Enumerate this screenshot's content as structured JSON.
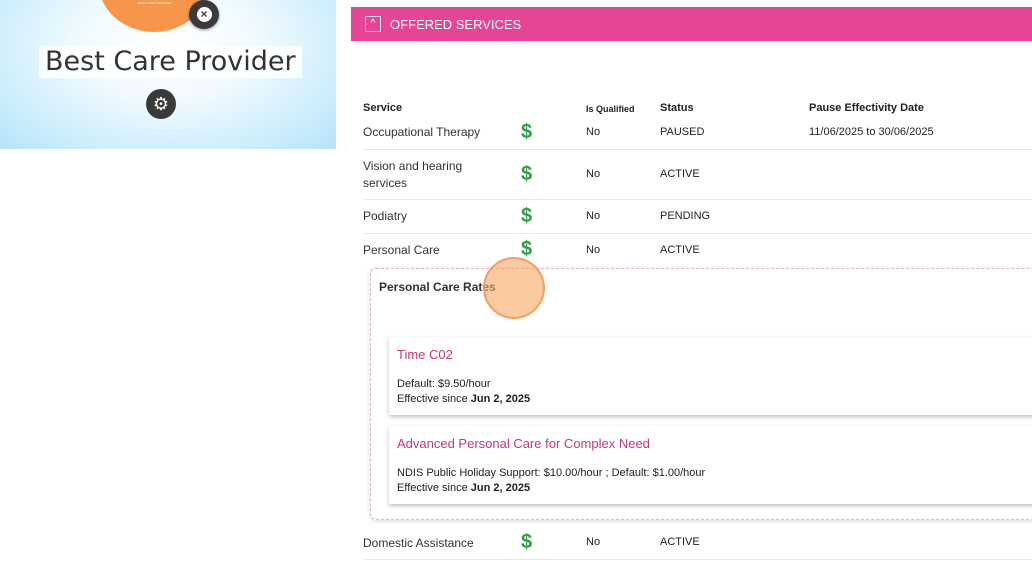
{
  "provider": {
    "name": "Best Care Provider",
    "logo_text": "BEST CARE PROVIDER"
  },
  "section": {
    "title": "OFFERED SERVICES",
    "toggle_symbol": "^"
  },
  "table": {
    "headers": {
      "service": "Service",
      "qualified": "Is Qualified",
      "status": "Status",
      "pause": "Pause Effectivity Date"
    },
    "rows": [
      {
        "name": "Occupational Therapy",
        "dollar": "$",
        "qualified": "No",
        "status": "PAUSED",
        "pause": "11/06/2025 to 30/06/2025"
      },
      {
        "name": "Vision and hearing services",
        "dollar": "$",
        "qualified": "No",
        "status": "ACTIVE",
        "pause": ""
      },
      {
        "name": "Podiatry",
        "dollar": "$",
        "qualified": "No",
        "status": "PENDING",
        "pause": ""
      },
      {
        "name": "Personal Care",
        "dollar": "$",
        "qualified": "No",
        "status": "ACTIVE",
        "pause": ""
      },
      {
        "name": "Domestic Assistance",
        "dollar": "$",
        "qualified": "No",
        "status": "ACTIVE",
        "pause": ""
      }
    ]
  },
  "rates": {
    "title": "Personal Care Rates",
    "cards": [
      {
        "name": "Time C02",
        "detail": "Default: $9.50/hour",
        "effective_prefix": "Effective since",
        "effective_date": "Jun 2, 2025"
      },
      {
        "name": "Advanced Personal Care for Complex Need",
        "detail": "NDIS Public Holiday Support: $10.00/hour ; Default: $1.00/hour",
        "effective_prefix": "Effective since",
        "effective_date": "Jun 2, 2025"
      }
    ]
  },
  "icons": {
    "remove": "close-icon",
    "settings": "gear-icon",
    "dollar": "dollar-icon",
    "collapse": "chevron-up-icon"
  },
  "colors": {
    "header": "#e64595",
    "dollar": "#2ea043",
    "rate_name": "#c2397a",
    "logo": "#f7954a"
  }
}
